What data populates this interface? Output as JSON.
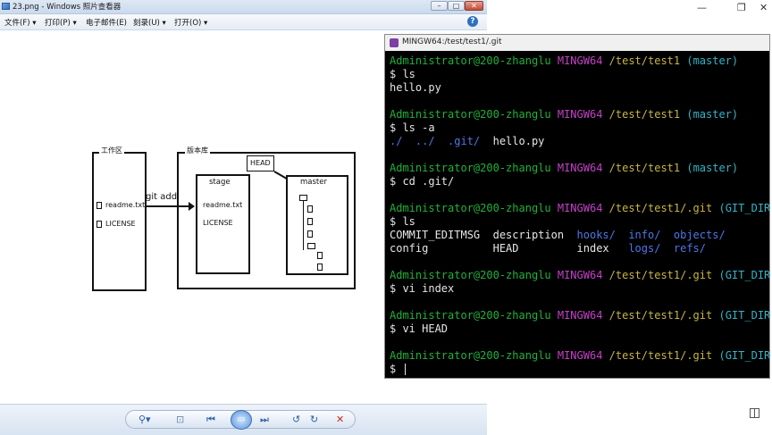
{
  "viewer": {
    "title": "23.png - Windows 照片查看器",
    "menu": [
      "文件(F)",
      "打印(P)",
      "电子邮件(E)",
      "刻录(U)",
      "打开(O)"
    ],
    "help": "?"
  },
  "diagram": {
    "workspace_label": "工作区",
    "repo_label": "版本库",
    "files": [
      "readme.txt",
      "LICENSE"
    ],
    "git_add": "git add",
    "stage_label": "stage",
    "stage_files": [
      "readme.txt",
      "LICENSE"
    ],
    "head_label": "HEAD",
    "master_label": "master"
  },
  "terminal": {
    "title": "MINGW64:/test/test1/.git",
    "lines": [
      [
        [
          "g",
          "Administrator@200-zhanglu "
        ],
        [
          "m",
          "MINGW64 "
        ],
        [
          "y",
          "/test/test1 "
        ],
        [
          "c",
          "(master)"
        ]
      ],
      [
        [
          "w",
          "$ ls"
        ]
      ],
      [
        [
          "w",
          "hello.py"
        ]
      ],
      [
        [
          "w",
          ""
        ]
      ],
      [
        [
          "g",
          "Administrator@200-zhanglu "
        ],
        [
          "m",
          "MINGW64 "
        ],
        [
          "y",
          "/test/test1 "
        ],
        [
          "c",
          "(master)"
        ]
      ],
      [
        [
          "w",
          "$ ls -a"
        ]
      ],
      [
        [
          "b",
          "./  ../  .git/"
        ],
        [
          "w",
          "  hello.py"
        ]
      ],
      [
        [
          "w",
          ""
        ]
      ],
      [
        [
          "g",
          "Administrator@200-zhanglu "
        ],
        [
          "m",
          "MINGW64 "
        ],
        [
          "y",
          "/test/test1 "
        ],
        [
          "c",
          "(master)"
        ]
      ],
      [
        [
          "w",
          "$ cd .git/"
        ]
      ],
      [
        [
          "w",
          ""
        ]
      ],
      [
        [
          "g",
          "Administrator@200-zhanglu "
        ],
        [
          "m",
          "MINGW64 "
        ],
        [
          "y",
          "/test/test1/.git "
        ],
        [
          "c",
          "(GIT_DIR!)"
        ]
      ],
      [
        [
          "w",
          "$ ls"
        ]
      ],
      [
        [
          "w",
          "COMMIT_EDITMSG  description  "
        ],
        [
          "b",
          "hooks/  info/  objects/"
        ]
      ],
      [
        [
          "w",
          "config          HEAD         index   "
        ],
        [
          "b",
          "logs/  refs/"
        ]
      ],
      [
        [
          "w",
          ""
        ]
      ],
      [
        [
          "g",
          "Administrator@200-zhanglu "
        ],
        [
          "m",
          "MINGW64 "
        ],
        [
          "y",
          "/test/test1/.git "
        ],
        [
          "c",
          "(GIT_DIR!)"
        ]
      ],
      [
        [
          "w",
          "$ vi index"
        ]
      ],
      [
        [
          "w",
          ""
        ]
      ],
      [
        [
          "g",
          "Administrator@200-zhanglu "
        ],
        [
          "m",
          "MINGW64 "
        ],
        [
          "y",
          "/test/test1/.git "
        ],
        [
          "c",
          "(GIT_DIR!)"
        ]
      ],
      [
        [
          "w",
          "$ vi HEAD"
        ]
      ],
      [
        [
          "w",
          ""
        ]
      ],
      [
        [
          "g",
          "Administrator@200-zhanglu "
        ],
        [
          "m",
          "MINGW64 "
        ],
        [
          "y",
          "/test/test1/.git "
        ],
        [
          "c",
          "(GIT_DIR!)"
        ]
      ],
      [
        [
          "w",
          "$ "
        ]
      ]
    ]
  },
  "colors": {
    "prompt_user": "#1fb23b",
    "prompt_mingw": "#c640c8",
    "prompt_path": "#c8b640",
    "prompt_branch": "#31b5c8",
    "dir": "#4f77e8"
  }
}
